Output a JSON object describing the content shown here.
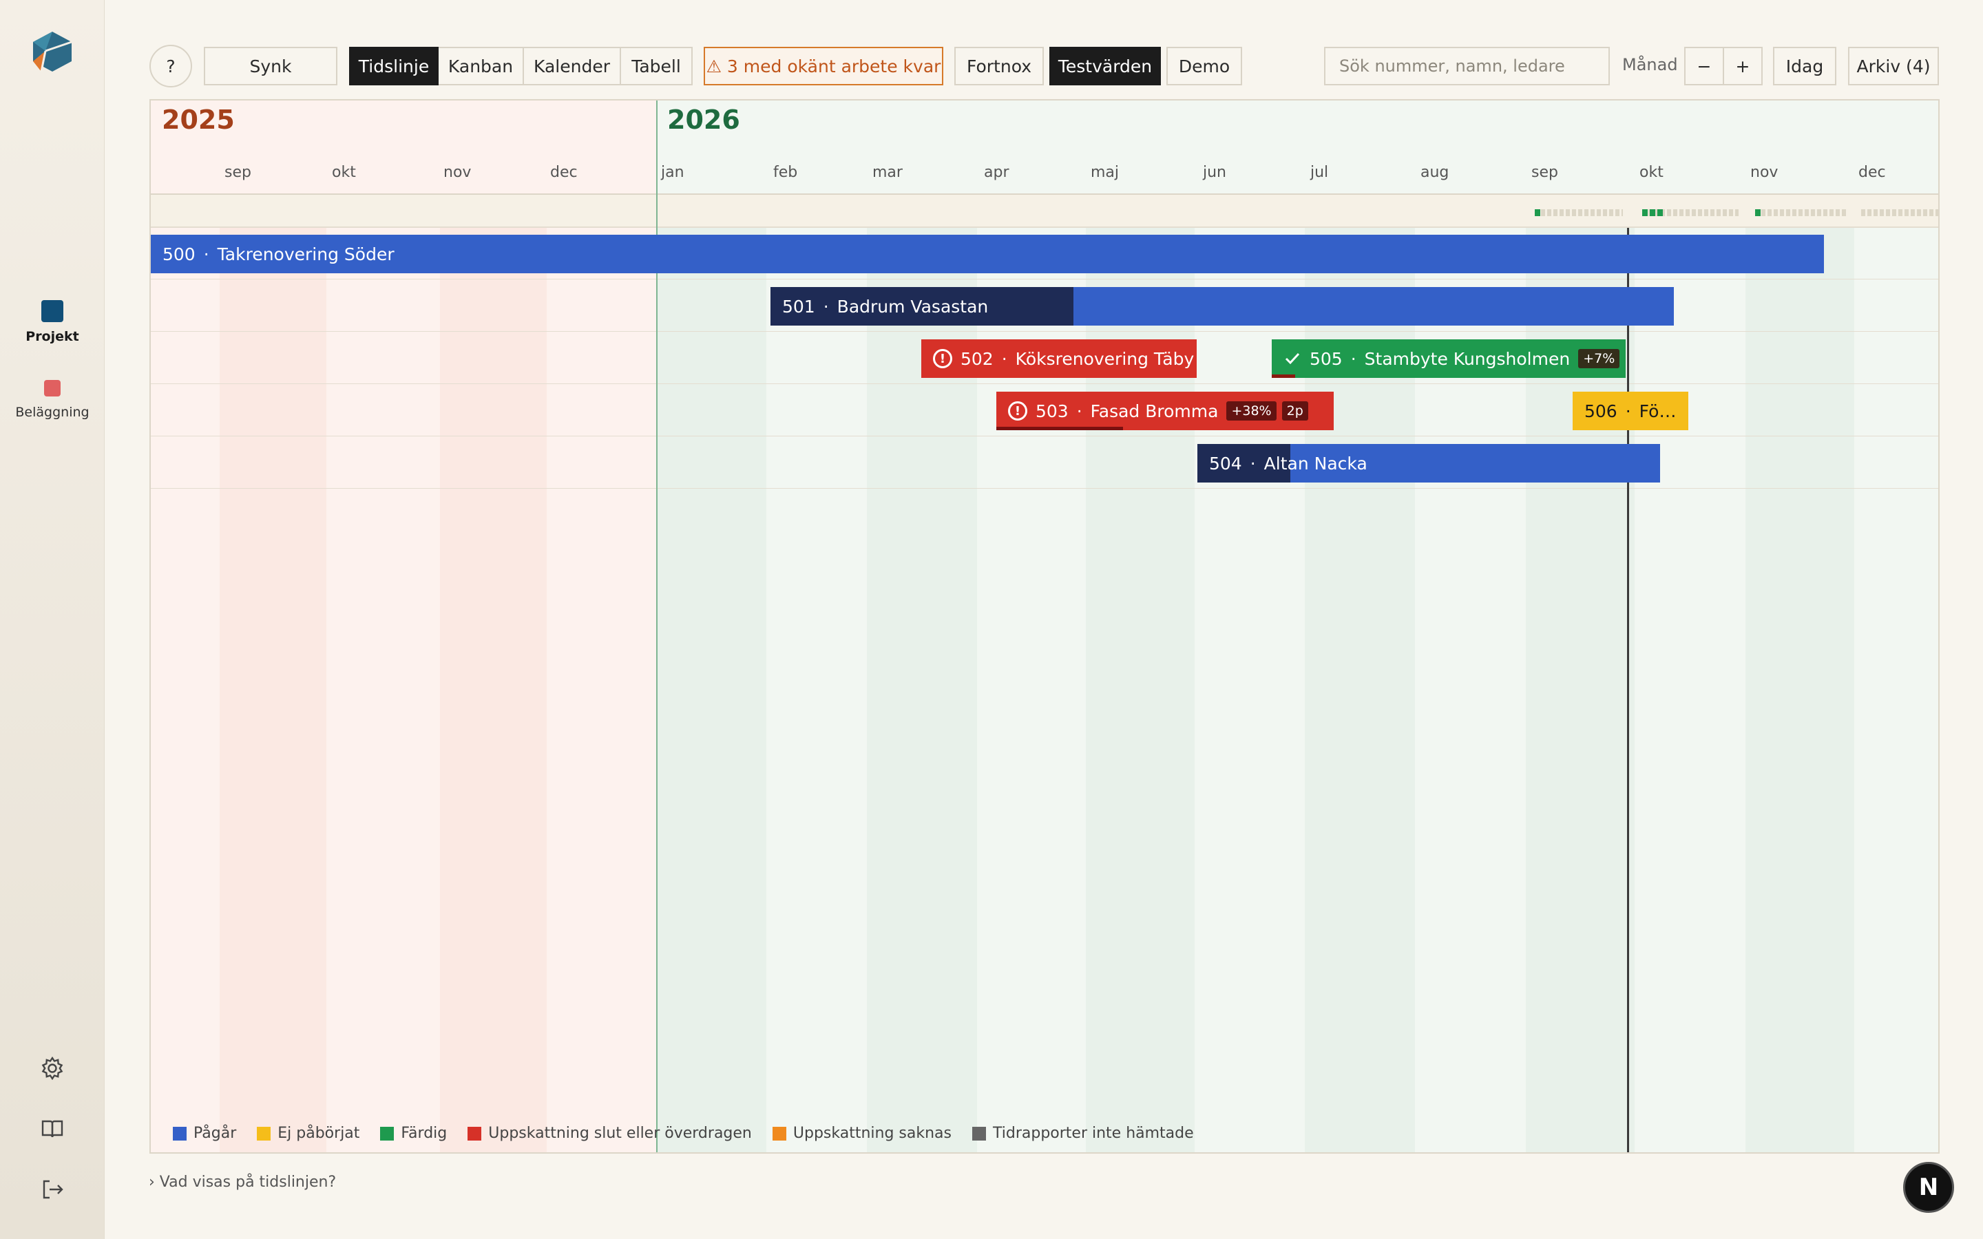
{
  "sidebar": {
    "items": [
      {
        "label": "Projekt",
        "color": "#114f78"
      },
      {
        "label": "Beläggning",
        "color": "#e06060"
      }
    ],
    "bottom_icons": [
      "gear-icon",
      "book-icon",
      "logout-icon"
    ]
  },
  "toolbar": {
    "help": "?",
    "sync": "Synk",
    "views": [
      "Tidslinje",
      "Kanban",
      "Kalender",
      "Tabell"
    ],
    "active_view": "Tidslinje",
    "warning": "⚠  3 med okänt arbete kvar",
    "fortnox": "Fortnox",
    "testvarden": "Testvärden",
    "demo": "Demo",
    "search_placeholder": "Sök nummer, namn, ledare",
    "scale_label": "Månad",
    "zoom_out": "−",
    "zoom_in": "+",
    "today": "Idag",
    "archive": "Arkiv (4)"
  },
  "timeline": {
    "years": [
      {
        "label": "2025",
        "color": "#a4401a"
      },
      {
        "label": "2026",
        "color": "#1e6b3f"
      }
    ],
    "months": [
      "sep",
      "okt",
      "nov",
      "dec",
      "jan",
      "feb",
      "mar",
      "apr",
      "maj",
      "jun",
      "jul",
      "aug",
      "sep",
      "okt",
      "nov",
      "dec"
    ],
    "projects": [
      {
        "number": "500",
        "name": "Takrenovering Söder",
        "status": "Pågår",
        "color": "#3460c8"
      },
      {
        "number": "501",
        "name": "Badrum Vasastan",
        "status": "Pågår",
        "color": "#3460c8"
      },
      {
        "number": "502",
        "name": "Köksrenovering Täby",
        "status": "Uppskattning slut eller överdragen",
        "color": "#d63128"
      },
      {
        "number": "505",
        "name": "Stambyte Kungsholmen",
        "status": "Färdig",
        "color": "#1e9a4e",
        "badges": [
          "+7%"
        ]
      },
      {
        "number": "503",
        "name": "Fasad Bromma",
        "status": "Uppskattning slut eller överdragen",
        "color": "#d63128",
        "badges": [
          "+38%",
          "2p"
        ]
      },
      {
        "number": "506",
        "name": "Fö…",
        "status": "Ej påbörjat",
        "color": "#f5bd1a"
      },
      {
        "number": "504",
        "name": "Altan Nacka",
        "status": "Pågår",
        "color": "#3460c8"
      }
    ]
  },
  "legend": [
    {
      "label": "Pågår",
      "color": "#3460c8"
    },
    {
      "label": "Ej påbörjat",
      "color": "#f5bd1a"
    },
    {
      "label": "Färdig",
      "color": "#1e9a4e"
    },
    {
      "label": "Uppskattning slut eller överdragen",
      "color": "#d63128"
    },
    {
      "label": "Uppskattning saknas",
      "color": "#f08a1e"
    },
    {
      "label": "Tidrapporter inte hämtade",
      "color": "#666666"
    }
  ],
  "footer": {
    "help_link": "› Vad visas på tidslinjen?",
    "avatar_letter": "N"
  }
}
